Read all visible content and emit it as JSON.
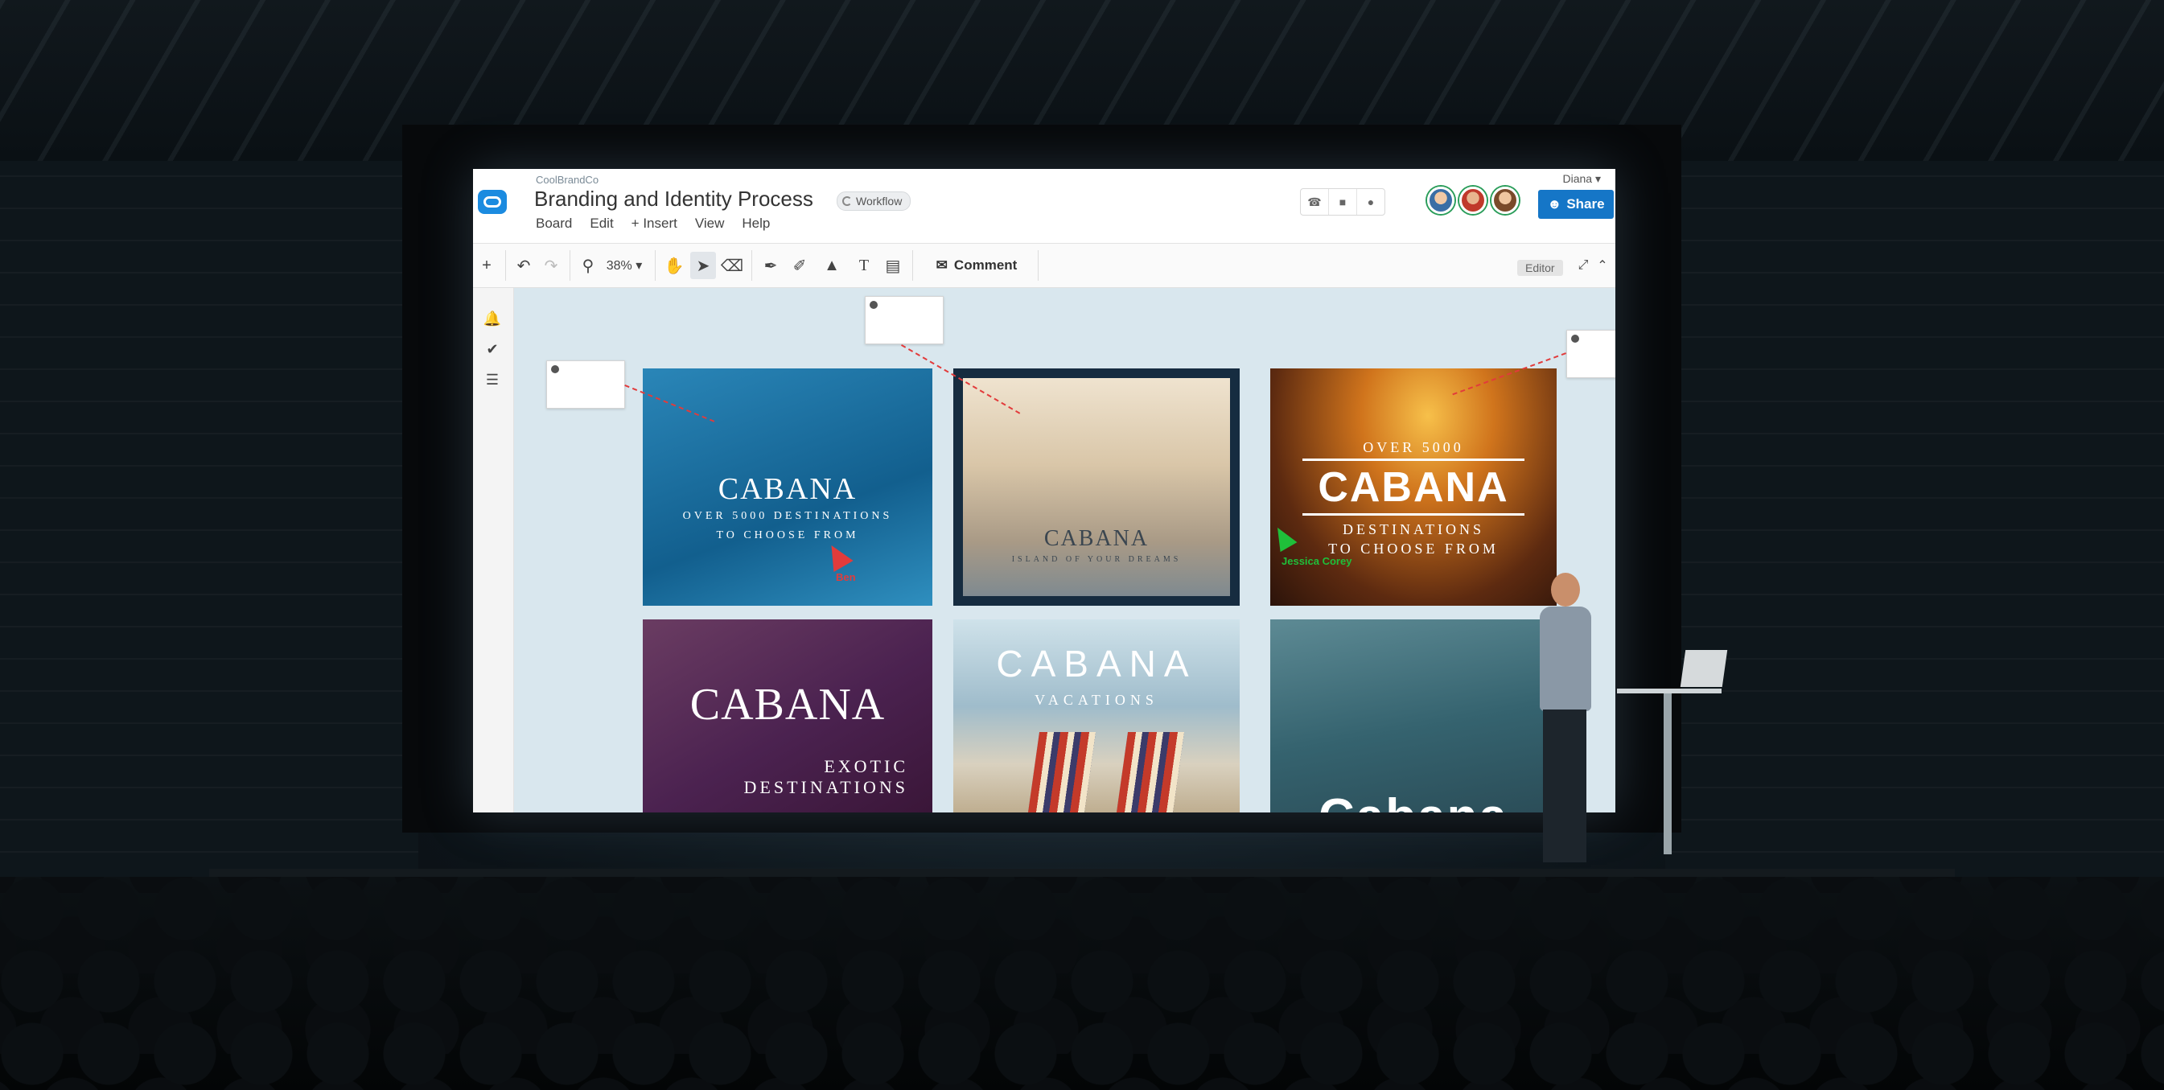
{
  "app": {
    "org": "CoolBrandCo",
    "title": "Branding and Identity Process",
    "workflow_label": "Workflow",
    "user": "Diana ▾",
    "share_label": "Share",
    "menu": [
      "Board",
      "Edit",
      "+ Insert",
      "View",
      "Help"
    ]
  },
  "toolbar": {
    "zoom": "38% ▾",
    "comment_label": "Comment",
    "editor_label": "Editor"
  },
  "cards": {
    "c1": {
      "brand": "CABANA",
      "line1": "OVER 5000 DESTINATIONS",
      "line2": "TO CHOOSE FROM"
    },
    "c2": {
      "brand": "CABANA",
      "line1": "ISLAND OF YOUR DREAMS"
    },
    "c3": {
      "top": "OVER 5000",
      "brand": "CABANA",
      "line1": "DESTINATIONS",
      "line2": "TO CHOOSE FROM"
    },
    "c4": {
      "brand": "CABANA",
      "line1": "EXOTIC",
      "line2": "DESTINATIONS"
    },
    "c5": {
      "brand": "CABANA",
      "line1": "VACATIONS"
    },
    "c6": {
      "brand": "Cabana"
    }
  },
  "cursors": {
    "red_name": "Ben",
    "green_name": "Jessica Corey"
  },
  "colors": {
    "share_blue": "#1576c7",
    "canvas": "#d9e7ee",
    "cursor_red": "#e23b3b",
    "cursor_green": "#1fbf3a"
  }
}
